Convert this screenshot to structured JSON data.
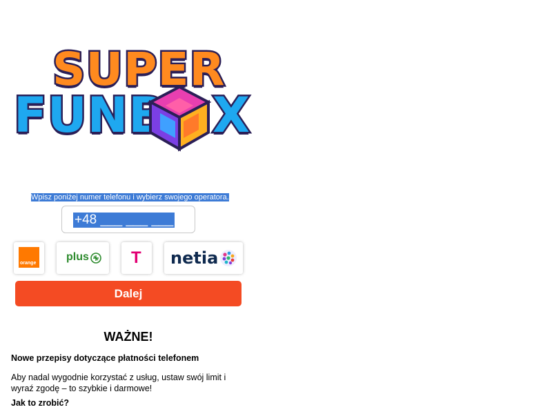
{
  "brand": {
    "logo_line1": "SUPER",
    "logo_line2": "FUNB",
    "logo_line2_end": "X",
    "colors": {
      "super": "#ff8a1f",
      "fun": "#1ea8f0",
      "outline": "#2b1f57"
    }
  },
  "form": {
    "instruction": "Wpisz poniżej numer telefonu i wybierz swojego operatora.",
    "phone_value": "+48 ___ ___ ___"
  },
  "operators": [
    {
      "name": "orange",
      "label": "orange",
      "icon": "orange-logo-icon",
      "color": "#ff7900"
    },
    {
      "name": "plus",
      "label": "plus",
      "icon": "plus-logo-icon",
      "color": "#2c8a2c"
    },
    {
      "name": "t-mobile",
      "label": "T",
      "icon": "t-mobile-logo-icon",
      "color": "#e20074"
    },
    {
      "name": "netia",
      "label": "netia",
      "icon": "netia-logo-icon",
      "color": "#0f2a4f"
    }
  ],
  "actions": {
    "next_label": "Dalej",
    "accent": "#f44b23"
  },
  "notice": {
    "heading": "WAŻNE!",
    "title": "Nowe przepisy dotyczące płatności telefonem",
    "body": "Aby nadal wygodnie korzystać z usług, ustaw swój limit i wyraź zgodę – to szybkie i darmowe!",
    "howto": "Jak to zrobić?"
  }
}
